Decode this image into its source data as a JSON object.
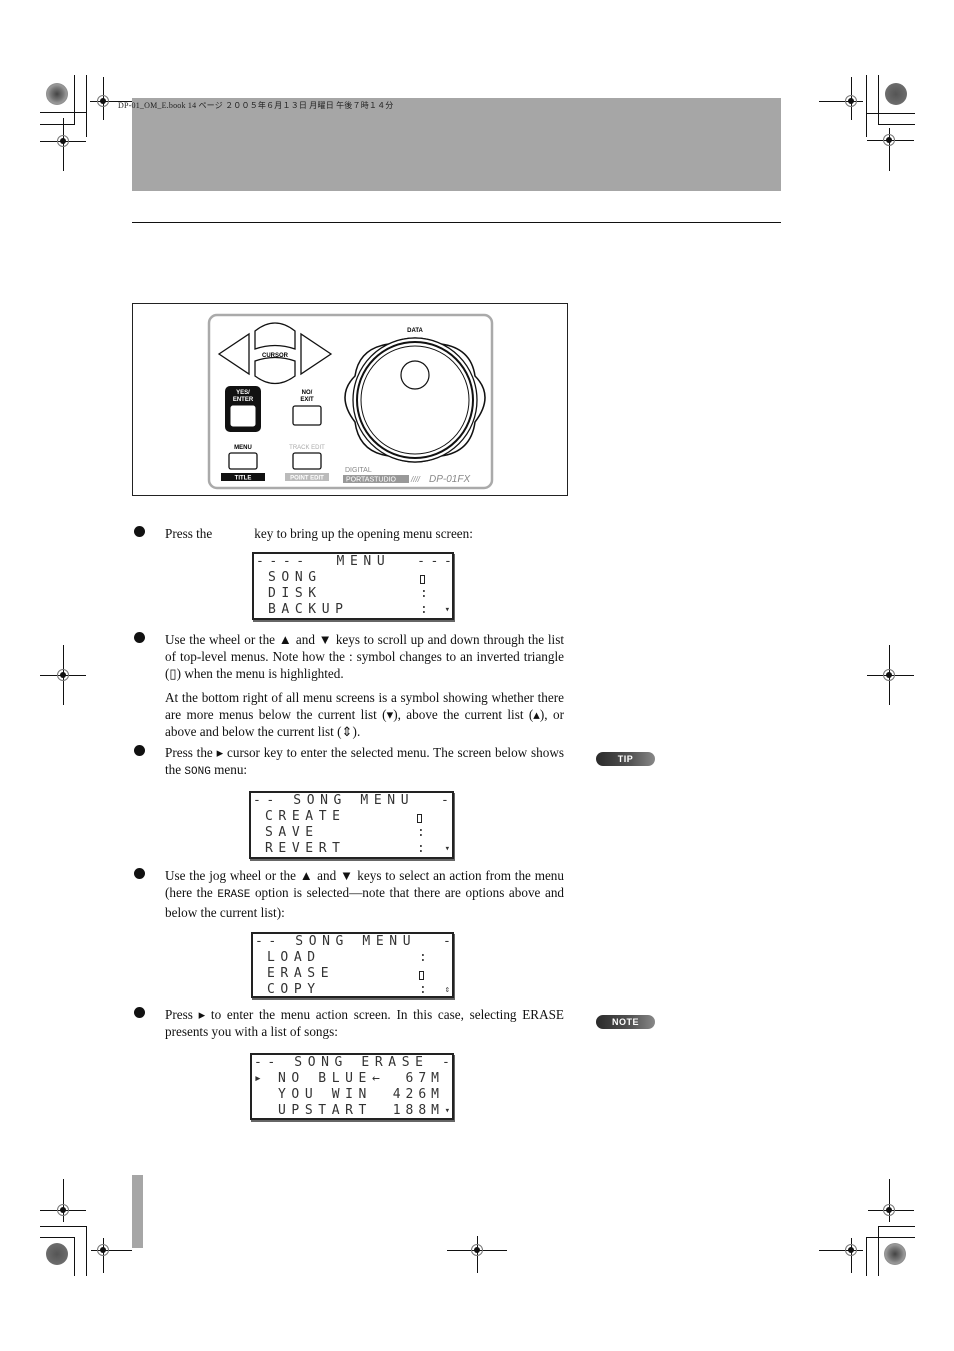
{
  "header": {
    "slug_text": "DP-01_OM_E.book  14 ページ  ２００５年６月１３日  月曜日  午後７時１４分"
  },
  "panel": {
    "cursor_label": "CURSOR",
    "data_label": "DATA",
    "yes_enter_label_line1": "YES/",
    "yes_enter_label_line2": "ENTER",
    "no_exit_label_line1": "NO/",
    "no_exit_label_line2": "EXIT",
    "menu_label": "MENU",
    "title_label": "TITLE",
    "track_edit_label": "TRACK EDIT",
    "point_edit_label": "POINT EDIT",
    "brand_digital": "DIGITAL",
    "brand_portastudio": "PORTASTUDIO",
    "brand_slashes": "////",
    "model": "DP-01FX"
  },
  "steps": [
    {
      "text_before": "Press the",
      "text_after": "key to bring up the opening menu screen:"
    },
    {
      "text": "Use the wheel or the ▲ and ▼ keys to scroll up and down through the list of top-level menus. Note how the : symbol changes to an inverted triangle (▯) when the menu is highlighted.",
      "note": "At the bottom right of all menu screens is a symbol showing whether there are more menus below the current list (▾), above the current list (▴), or above and below the current list (⇕)."
    },
    {
      "text_before": "Press the ▸ cursor key to enter the selected menu. The screen below shows the",
      "mono": "SONG",
      "text_after": "menu:"
    },
    {
      "text_before": "Use the jog wheel or the ▲ and ▼ keys to select an action from the menu (here the",
      "mono": "ERASE",
      "text_after": "option is selected—note that there are options above and below the current list):"
    },
    {
      "text": "Press ▸ to enter the menu action screen. In this case, selecting ERASE presents you with a list of songs:"
    }
  ],
  "screens": {
    "menu": {
      "title": "----  MENU  ----",
      "rows": [
        {
          "label": "SONG",
          "marker": "selected",
          "scroll": ""
        },
        {
          "label": "DISK",
          "marker": ":",
          "scroll": ""
        },
        {
          "label": "BACKUP",
          "marker": ":",
          "scroll": "▾"
        }
      ]
    },
    "song_menu": {
      "title": "-- SONG MENU  --",
      "rows": [
        {
          "label": "CREATE",
          "marker": "selected",
          "scroll": ""
        },
        {
          "label": "SAVE",
          "marker": ":",
          "scroll": ""
        },
        {
          "label": "REVERT",
          "marker": ":",
          "scroll": "▾"
        }
      ]
    },
    "song_menu_erase": {
      "title": "-- SONG MENU  --",
      "rows": [
        {
          "label": "LOAD",
          "marker": ":",
          "scroll": ""
        },
        {
          "label": "ERASE",
          "marker": "selected",
          "scroll": ""
        },
        {
          "label": "COPY",
          "marker": ":",
          "scroll": "⇕"
        }
      ]
    },
    "song_erase": {
      "title": "-- SONG ERASE --",
      "rows": [
        {
          "pointer": "▸",
          "label": "NO BLUE←",
          "size": "67M",
          "scroll": ""
        },
        {
          "pointer": "",
          "label": "YOU WIN",
          "size": "426M",
          "scroll": ""
        },
        {
          "pointer": "",
          "label": "UPSTART",
          "size": "188M",
          "scroll": "▾"
        }
      ]
    }
  },
  "sidebar": {
    "tip_label": "TIP",
    "note_label": "NOTE"
  }
}
